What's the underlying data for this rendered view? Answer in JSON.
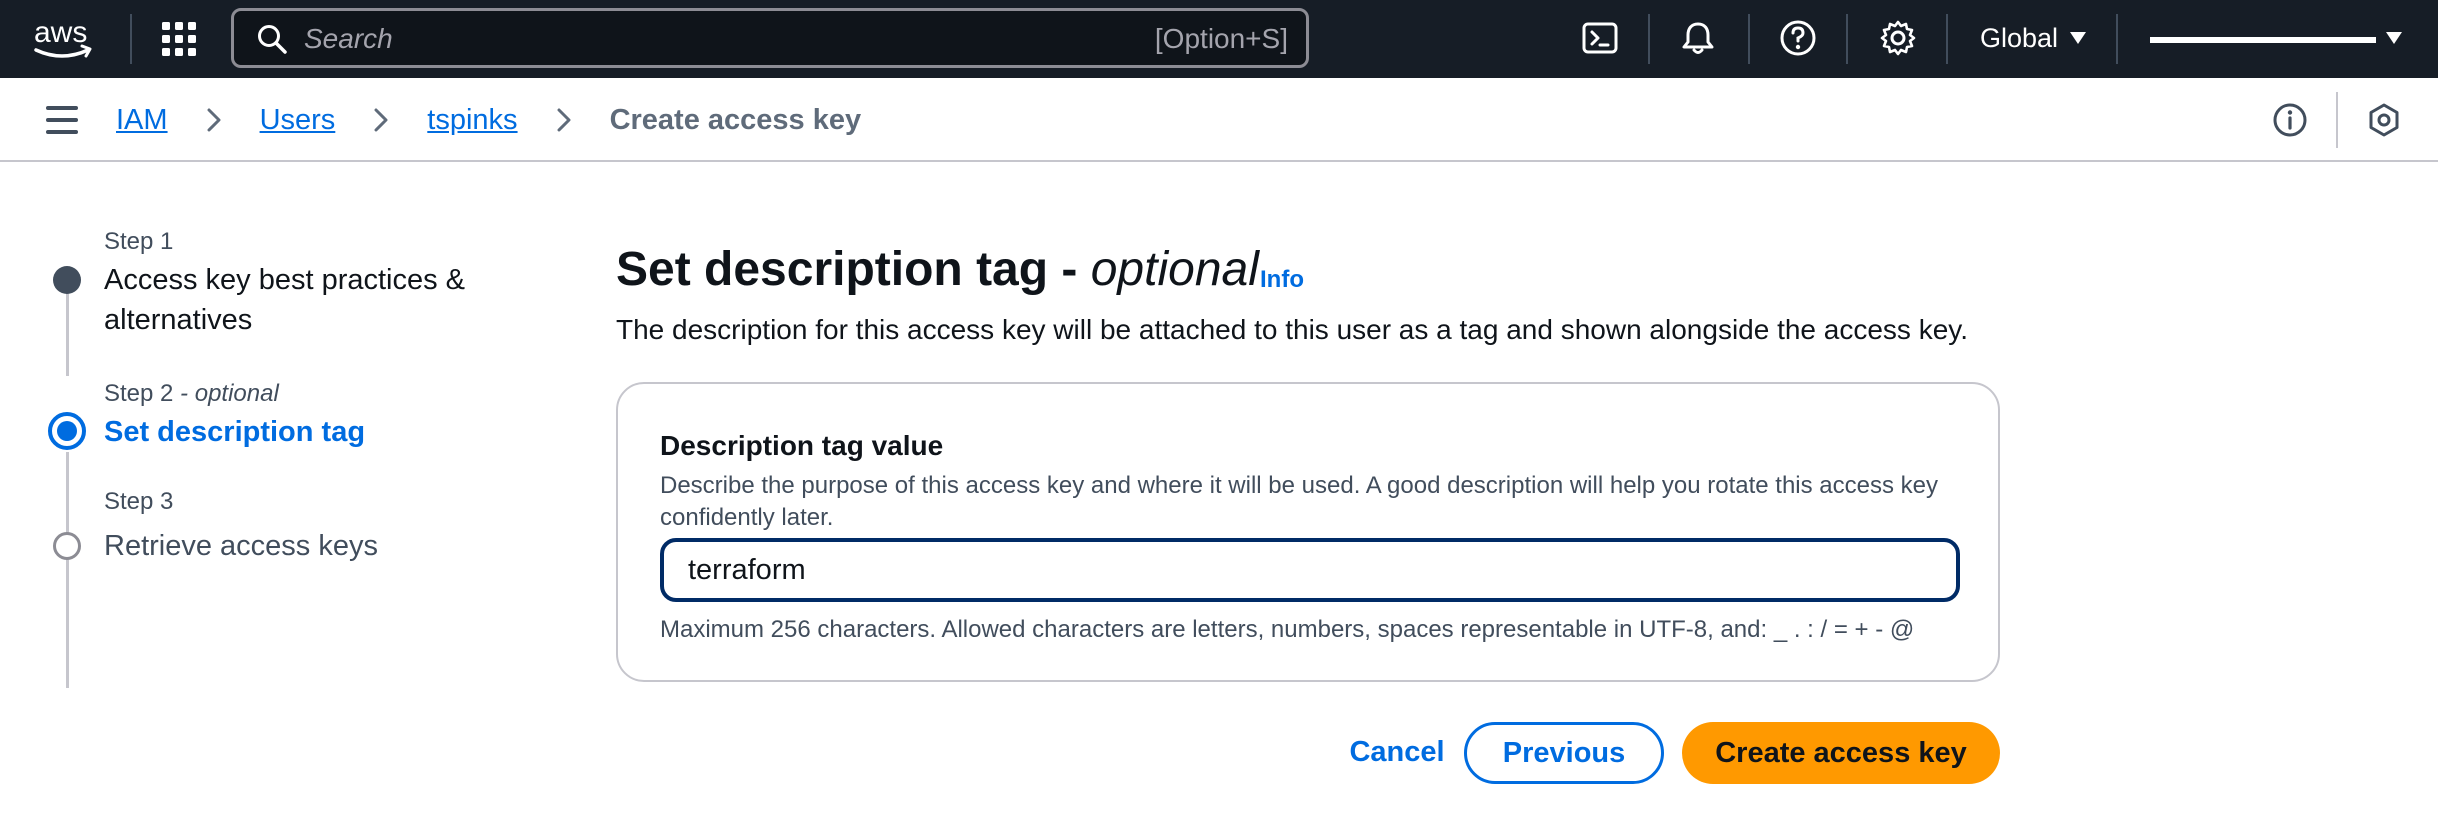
{
  "topnav": {
    "logo_text": "aws",
    "search": {
      "placeholder": "Search",
      "value": "",
      "shortcut": "[Option+S]"
    },
    "icons": [
      "cloudshell-icon",
      "bell-icon",
      "help-icon",
      "gear-icon"
    ],
    "region": "Global",
    "account_redacted": true
  },
  "breadcrumb": {
    "items": [
      {
        "label": "IAM",
        "link": true
      },
      {
        "label": "Users",
        "link": true
      },
      {
        "label": "tspinks",
        "link": true
      },
      {
        "label": "Create access key",
        "link": false
      }
    ]
  },
  "wizard": {
    "steps": [
      {
        "caption": "Step 1",
        "caption_optional": "",
        "title": "Access key best practices & alternatives",
        "state": "completed"
      },
      {
        "caption": "Step 2",
        "caption_optional": " - optional",
        "title": "Set description tag",
        "state": "current"
      },
      {
        "caption": "Step 3",
        "caption_optional": "",
        "title": "Retrieve access keys",
        "state": "upcoming"
      }
    ]
  },
  "main": {
    "heading": "Set description tag - ",
    "heading_optional": "optional",
    "info_link": "Info",
    "description": "The description for this access key will be attached to this user as a tag and shown alongside the access key.",
    "field": {
      "label": "Description tag value",
      "help": "Describe the purpose of this access key and where it will be used. A good description will help you rotate this access key confidently later.",
      "value": "terraform",
      "constraint": "Maximum 256 characters. Allowed characters are letters, numbers, spaces representable in UTF-8, and: _ . : / = + - @"
    },
    "buttons": {
      "cancel": "Cancel",
      "previous": "Previous",
      "create": "Create access key"
    }
  },
  "colors": {
    "nav_bg": "#161d26",
    "link": "#006ce0",
    "primary_button": "#ff9900",
    "completed_step": "#414d5c"
  }
}
